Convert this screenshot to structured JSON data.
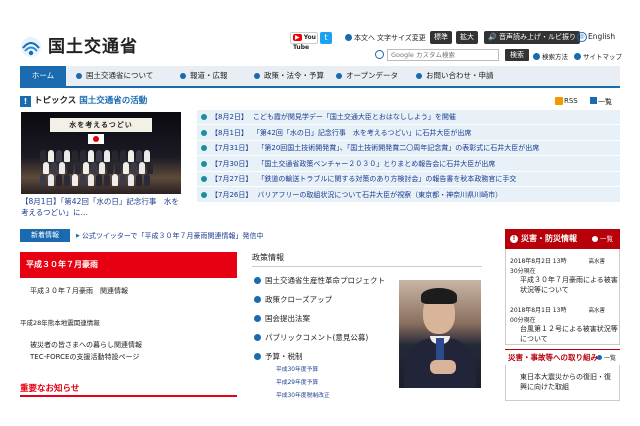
{
  "header": {
    "site_title": "国土交通省",
    "youtube": "You Tube",
    "honbun": "本文へ",
    "moji_size": "文字サイズ変更",
    "standard": "標準",
    "large": "拡大",
    "voice": "音声読み上げ・ルビ振り",
    "english": "English",
    "search_placeholder": "Google カスタム検索",
    "search_button": "検索",
    "howto": "検索方法",
    "sitemap": "サイトマップ"
  },
  "nav": {
    "items": [
      "ホーム",
      "国土交通省について",
      "報道・広報",
      "政策・法令・予算",
      "オープンデータ",
      "お問い合わせ・申請"
    ]
  },
  "topics": {
    "prefix": "トピックス",
    "title": "国土交通省の活動",
    "rss": "RSS",
    "list_all": "一覧",
    "photo_banner": "水を考えるつどい",
    "caption": "【8月1日】「第42回「水の日」記念行事　水を考えるつどい」に…",
    "items": [
      {
        "date": "【8月2日】",
        "text": "こども霞が関見学デー「国土交通大臣とおはなししよう」を開催"
      },
      {
        "date": "【8月1日】",
        "text": "「第42回「水の日」記念行事　水を考えるつどい」に石井大臣が出席"
      },
      {
        "date": "【7月31日】",
        "text": "「第20回国土技術開発賞」、「国土技術開発賞二〇周年記念賞」の表彰式に石井大臣が出席"
      },
      {
        "date": "【7月30日】",
        "text": "「国土交通省政策ベンチャー２０３０」とりまとめ報告会に石井大臣が出席"
      },
      {
        "date": "【7月27日】",
        "text": "「鉄道の輸送トラブルに関する対策のあり方検討会」の報告書を秋本政務官に手交"
      },
      {
        "date": "【7月26日】",
        "text": "バリアフリーの取組状況について石井大臣が視察（東京都・神奈川県川崎市）"
      }
    ]
  },
  "news": {
    "label": "新着情報",
    "text": "公式ツイッターで「平成３０年７月豪雨関連情報」発信中"
  },
  "left": {
    "heavy_rain": "平成３０年７月豪雨",
    "heavy_rain_link": "平成３０年７月豪雨　関連情報",
    "kumamoto_title": "平成28年熊本地震関連情報",
    "kumamoto_l1": "被災者の皆さまへの暮らし関連情報",
    "kumamoto_l2": "TEC-FORCEの支援活動特設ページ",
    "important_prefix": "重要",
    "important_suffix": "なお知らせ"
  },
  "policy": {
    "title": "政策情報",
    "items": [
      "国土交通省生産性革命プロジェクト",
      "政策クローズアップ",
      "国会提出法案",
      "パブリックコメント(意見公募)",
      "予算・税制"
    ],
    "budget_sub": [
      "平成30年度予算",
      "平成29年度予算",
      "平成30年度税制改正"
    ]
  },
  "disaster": {
    "title": "災害・防災情報",
    "more": "一覧",
    "entries": [
      {
        "date": "2018年8月2日 13時",
        "kt": "高水害",
        "as_of": "30分現在",
        "link": "平成３０年７月豪雨による被害状況等について"
      },
      {
        "date": "2018年8月1日 13時",
        "kt": "高水害",
        "as_of": "00分現在",
        "link": "台風第１２号による被害状況等について"
      }
    ],
    "response_title": "災害・事故等への取り組み",
    "response_more": "一覧",
    "response_link": "東日本大震災からの復旧・復興に向けた取組"
  }
}
